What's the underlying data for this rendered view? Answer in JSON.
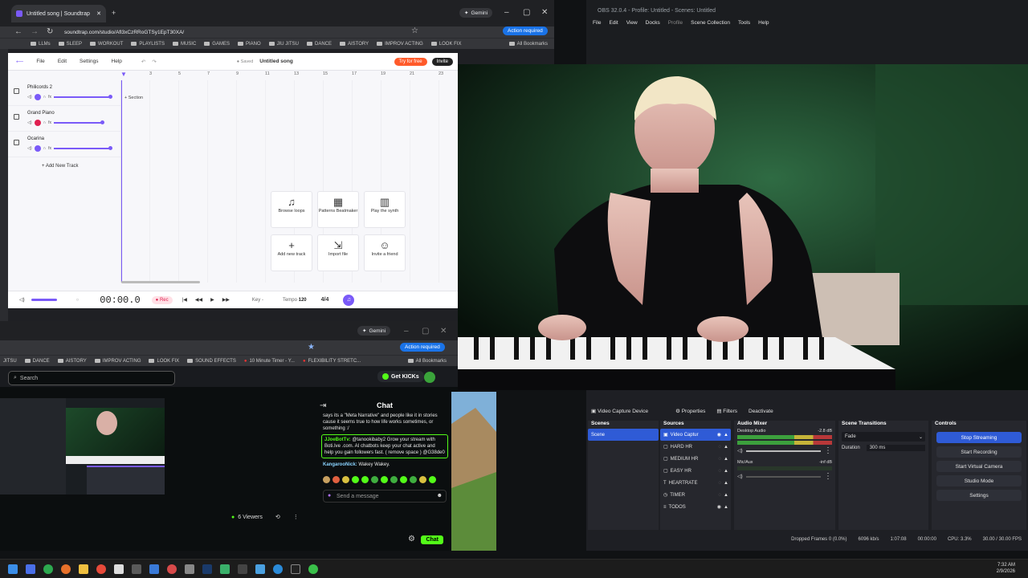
{
  "browser": {
    "tab_title": "Untitled song | Soundtrap",
    "url": "soundtrap.com/studio/Afl3xCzRRoGTSy1EpT30XA/",
    "gemini": "Gemini",
    "action_required": "Action required",
    "all_bookmarks": "All Bookmarks",
    "bookmarks": [
      "LLMs",
      "SLEEP",
      "WORKOUT",
      "PLAYLISTS",
      "MUSIC",
      "GAMES",
      "PIANO",
      "JIU JITSU",
      "DANCE",
      "AISTORY",
      "IMPROV ACTING",
      "LOOK FIX"
    ]
  },
  "soundtrap": {
    "menu": [
      "File",
      "Edit",
      "Settings",
      "Help"
    ],
    "status": "Saved",
    "song_title": "Untitled song",
    "try_free": "Try for free",
    "invite": "Invite",
    "section_label": "Section",
    "timeline_marks": [
      "3",
      "5",
      "7",
      "9",
      "11",
      "13",
      "15",
      "17",
      "19",
      "21",
      "23"
    ],
    "tracks": [
      {
        "name": "Philicords 2"
      },
      {
        "name": "Grand Piano"
      },
      {
        "name": "Ocarina"
      }
    ],
    "add_track": "Add New Track",
    "quick_actions": [
      {
        "label": "Browse loops",
        "icon": "♫"
      },
      {
        "label": "Patterns Beatmaker",
        "icon": "▦"
      },
      {
        "label": "Play the synth",
        "icon": "▥"
      },
      {
        "label": "Add new track",
        "icon": "+"
      },
      {
        "label": "Import file",
        "icon": "⇲"
      },
      {
        "label": "Invite a friend",
        "icon": "☺"
      }
    ],
    "timecode": "00:00.0",
    "rec": "Rec",
    "key_label": "Key",
    "key_value": "-",
    "tempo_label": "Tempo",
    "tempo_value": "120",
    "time_signature": "4/4"
  },
  "obs": {
    "title": "OBS 32.0.4 - Profile: Untitled - Scenes: Untitled",
    "menu": [
      "File",
      "Edit",
      "View",
      "Docks",
      "Profile",
      "Scene Collection",
      "Tools",
      "Help"
    ],
    "toolbar": {
      "source_name": "Video Capture Device",
      "properties": "Properties",
      "filters": "Filters",
      "deactivate": "Deactivate"
    },
    "scenes_title": "Scenes",
    "scenes": [
      "Scene"
    ],
    "sources_title": "Sources",
    "sources": [
      "Video Captur",
      "HARD HR",
      "MEDIUM HR",
      "EASY HR",
      "HEARTRATE",
      "TIMER",
      "TODOS"
    ],
    "mixer_title": "Audio Mixer",
    "mixer": [
      {
        "name": "Desktop Audio",
        "level": "-2.8 dB"
      },
      {
        "name": "Mic/Aux",
        "level": "-inf dB"
      }
    ],
    "transitions_title": "Scene Transitions",
    "transition_type": "Fade",
    "duration_label": "Duration",
    "duration_value": "300 ms",
    "controls_title": "Controls",
    "controls": [
      "Stop Streaming",
      "Start Recording",
      "Start Virtual Camera",
      "Studio Mode",
      "Settings"
    ],
    "status": {
      "dropped": "Dropped Frames 0 (0.0%)",
      "bitrate": "6096 kb/s",
      "stream_time": "1:07:08",
      "rec_time": "00:00:00",
      "cpu": "CPU: 3.3%",
      "fps": "30.00 / 30.00 FPS"
    }
  },
  "kick": {
    "gemini": "Gemini",
    "action_required": "Action required",
    "all_bookmarks": "All Bookmarks",
    "bookmarks": [
      "JITSU",
      "DANCE",
      "AISTORY",
      "IMPROV ACTING",
      "LOOK FIX",
      "SOUND EFFECTS",
      "10 Minute Timer - Y...",
      "FLEXIBILITY STRETC..."
    ],
    "search_placeholder": "Search",
    "get_kicks": "Get KICKs",
    "chat_title": "Chat",
    "messages": [
      {
        "user": "",
        "text": "says its a \"Meta Narrative\" and people like it in stories cause it seems true to how life works sometimes, or something :/"
      },
      {
        "user": "JJoeBotTv:",
        "text": "@tanookibaby2 Grow your stream with Boti.Ive .com. AI chatbots keep your chat active and help you gain followers fast. ( remove space ) @G38de0"
      },
      {
        "user": "KangarooNick:",
        "text": "Wakey Wakey."
      }
    ],
    "viewers": "6 Viewers",
    "send_placeholder": "Send a message",
    "chat_button": "Chat"
  },
  "taskbar": {
    "time": "7:32 AM",
    "date": "2/9/2026"
  }
}
